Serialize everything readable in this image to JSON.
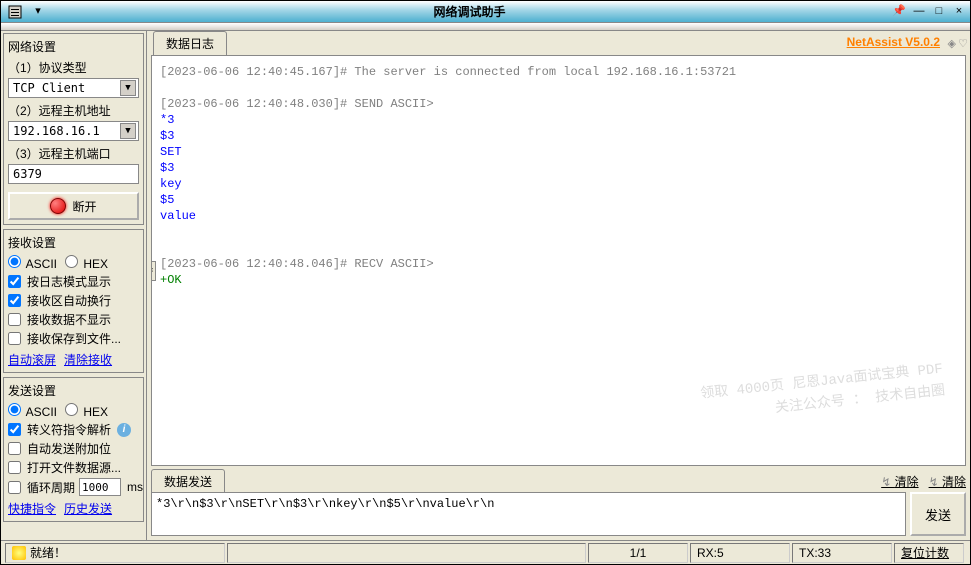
{
  "window": {
    "title": "网络调试助手",
    "brand": "NetAssist V5.0.2"
  },
  "net_settings": {
    "title": "网络设置",
    "protocol_label": "（1）协议类型",
    "protocol_value": "TCP Client",
    "host_label": "（2）远程主机地址",
    "host_value": "192.168.16.1",
    "port_label": "（3）远程主机端口",
    "port_value": "6379",
    "disconnect_label": "断开"
  },
  "recv_settings": {
    "title": "接收设置",
    "radio_ascii": "ASCII",
    "radio_hex": "HEX",
    "c1": "按日志模式显示",
    "c2": "接收区自动换行",
    "c3": "接收数据不显示",
    "c4": "接收保存到文件...",
    "link_scroll": "自动滚屏",
    "link_clear": "清除接收"
  },
  "send_settings": {
    "title": "发送设置",
    "radio_ascii": "ASCII",
    "radio_hex": "HEX",
    "c1": "转义符指令解析",
    "c2": "自动发送附加位",
    "c3": "打开文件数据源...",
    "c4_prefix": "循环周期",
    "c4_value": "1000",
    "c4_unit": "ms",
    "link_shortcut": "快捷指令",
    "link_history": "历史发送"
  },
  "log": {
    "tab": "数据日志",
    "lines": [
      {
        "cls": "gray",
        "text": "[2023-06-06 12:40:45.167]# The server is connected from local 192.168.16.1:53721"
      },
      {
        "cls": "",
        "text": ""
      },
      {
        "cls": "gray",
        "text": "[2023-06-06 12:40:48.030]# SEND ASCII>"
      },
      {
        "cls": "blue",
        "text": "*3"
      },
      {
        "cls": "blue",
        "text": "$3"
      },
      {
        "cls": "blue",
        "text": "SET"
      },
      {
        "cls": "blue",
        "text": "$3"
      },
      {
        "cls": "blue",
        "text": "key"
      },
      {
        "cls": "blue",
        "text": "$5"
      },
      {
        "cls": "blue",
        "text": "value"
      },
      {
        "cls": "",
        "text": ""
      },
      {
        "cls": "",
        "text": ""
      },
      {
        "cls": "gray",
        "text": "[2023-06-06 12:40:48.046]# RECV ASCII>"
      },
      {
        "cls": "green",
        "text": "+OK"
      }
    ]
  },
  "send_area": {
    "tab": "数据发送",
    "clear": "清除",
    "value": "*3\\r\\n$3\\r\\nSET\\r\\n$3\\r\\nkey\\r\\n$5\\r\\nvalue\\r\\n",
    "button": "发送"
  },
  "status": {
    "ready": "就绪！",
    "counter": "1/1",
    "rx": "RX:5",
    "tx": "TX:33",
    "reset": "复位计数"
  },
  "watermark": {
    "l1": "领取 4000页 尼恩Java面试宝典 PDF",
    "l2": "关注公众号 ：  技术自由圈"
  }
}
